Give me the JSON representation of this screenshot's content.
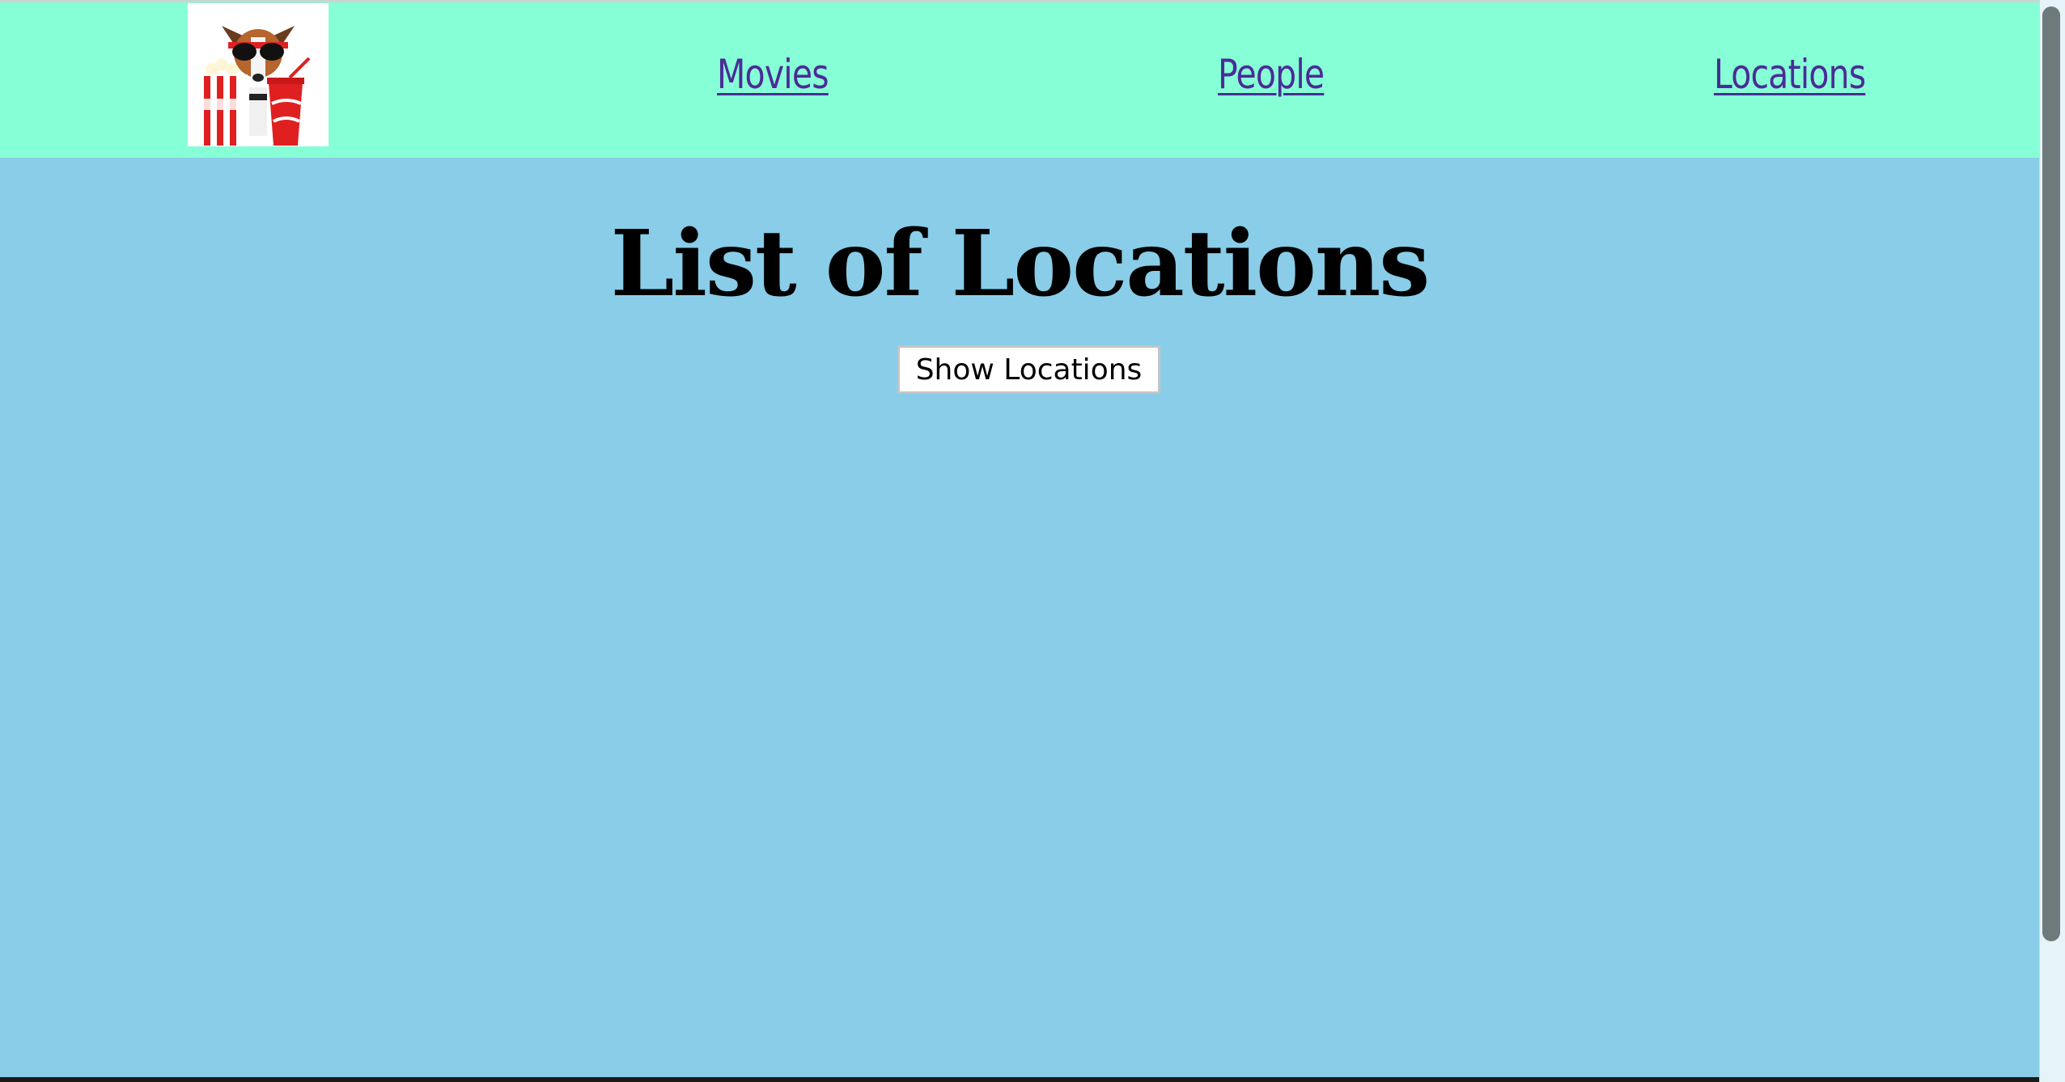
{
  "nav": {
    "logo_icon": "popcorn-dog-logo",
    "items": [
      {
        "label": "Movies"
      },
      {
        "label": "People"
      },
      {
        "label": "Locations"
      }
    ]
  },
  "main": {
    "title": "List of Locations",
    "show_button_label": "Show Locations"
  },
  "colors": {
    "navbar_bg": "#87ffd6",
    "page_bg": "#89cde8",
    "link": "#4a2c96"
  }
}
